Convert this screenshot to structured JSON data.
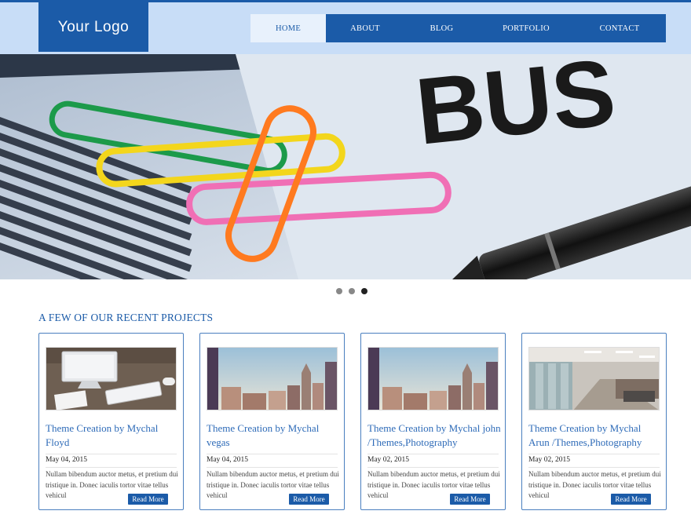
{
  "header": {
    "logo_text": "Your Logo",
    "nav": [
      {
        "label": "HOME",
        "active": true
      },
      {
        "label": "ABOUT",
        "active": false
      },
      {
        "label": "BLOG",
        "active": false
      },
      {
        "label": "PORTFOLIO",
        "active": false
      },
      {
        "label": "CONTACT",
        "active": false
      }
    ]
  },
  "hero": {
    "image_text": "BUS",
    "slides": 3,
    "active_slide": 3
  },
  "projects": {
    "title": "A FEW OF OUR RECENT PROJECTS",
    "read_more_label": "Read More",
    "items": [
      {
        "title": "Theme Creation by Mychal Floyd",
        "date": "May 04, 2015",
        "excerpt": "Nullam bibendum auctor metus, et pretium dui tristique in. Donec iaculis tortor vitae tellus vehicul",
        "image": "desk"
      },
      {
        "title": "Theme Creation by Mychal vegas",
        "date": "May 04, 2015",
        "excerpt": "Nullam bibendum auctor metus, et pretium dui tristique in. Donec iaculis tortor vitae tellus vehicul",
        "image": "city"
      },
      {
        "title": "Theme Creation by Mychal john /Themes,Photography",
        "date": "May 02, 2015",
        "excerpt": "Nullam bibendum auctor metus, et pretium dui tristique in. Donec iaculis tortor vitae tellus vehicul",
        "image": "city"
      },
      {
        "title": "Theme Creation by Mychal Arun /Themes,Photography",
        "date": "May 02, 2015",
        "excerpt": "Nullam bibendum auctor metus, et pretium dui tristique in. Donec iaculis tortor vitae tellus vehicul",
        "image": "office"
      }
    ]
  },
  "colors": {
    "brand": "#1b5ba8",
    "header_bg": "#c8ddf7",
    "link": "#2e6bb8"
  }
}
